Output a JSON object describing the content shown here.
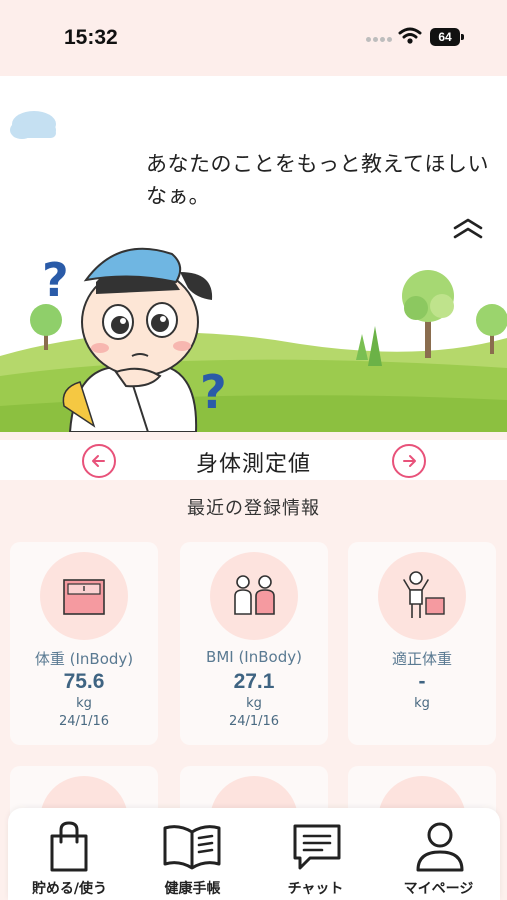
{
  "status_bar": {
    "time": "15:32",
    "battery": "64"
  },
  "hero": {
    "speech_text": "あなたのことをもっと教えてほしいなぁ。",
    "collapse_icon": "chevron-double-up-icon"
  },
  "section": {
    "title": "身体測定値",
    "prev_icon": "arrow-left-circle-icon",
    "next_icon": "arrow-right-circle-icon",
    "subheading": "最近の登録情報"
  },
  "cards": [
    {
      "icon": "scale-icon",
      "label": "体重 (InBody)",
      "value": "75.6",
      "unit": "kg",
      "date": "24/1/16"
    },
    {
      "icon": "people-icon",
      "label": "BMI (InBody)",
      "value": "27.1",
      "unit": "kg",
      "date": "24/1/16"
    },
    {
      "icon": "person-lifting-box-icon",
      "label": "適正体重",
      "value": "-",
      "unit": "kg",
      "date": ""
    }
  ],
  "tabbar": {
    "items": [
      {
        "label": "貯める/使う",
        "icon": "shopping-bag-icon"
      },
      {
        "label": "健康手帳",
        "icon": "open-book-icon"
      },
      {
        "label": "チャット",
        "icon": "chat-icon"
      },
      {
        "label": "マイページ",
        "icon": "user-icon"
      }
    ]
  },
  "colors": {
    "accent": "#e8527a",
    "background": "#fdf0ed",
    "value_text": "#3f6482",
    "icon_circle": "#fde3de"
  }
}
